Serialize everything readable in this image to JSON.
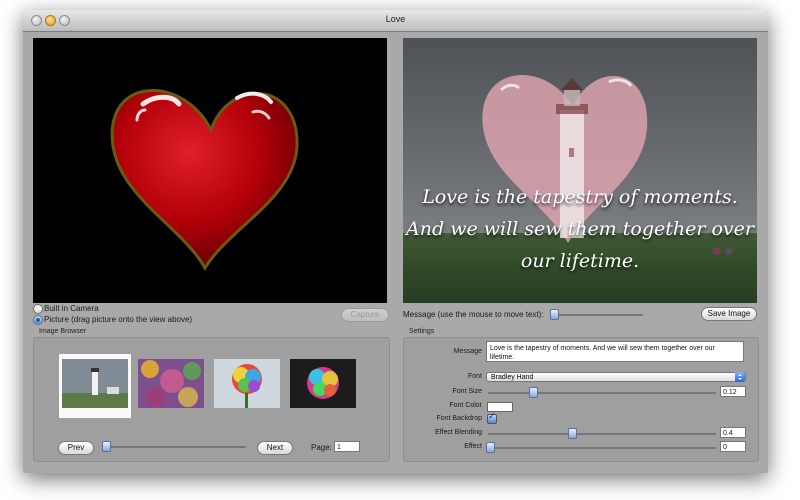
{
  "window": {
    "title": "Love"
  },
  "preview": {
    "quote_lines": [
      "Love is the tapestry of moments.",
      "And we will sew them together over",
      "our lifetime."
    ]
  },
  "source": {
    "radio_camera_label": "Built in Camera",
    "radio_picture_label": "Picture (drag picture onto the view above)",
    "selected": "picture",
    "capture_label": "Capture"
  },
  "message_bar": {
    "label": "Message (use the mouse to move text):",
    "save_label": "Save Image"
  },
  "image_browser": {
    "title": "Image Browser",
    "thumbnails": [
      "lighthouse-thumbnail",
      "flowers-thumbnail",
      "rainbow-rose-thumbnail",
      "rainbow-rose-2-thumbnail"
    ],
    "selected_index": 0,
    "prev_label": "Prev",
    "next_label": "Next",
    "page_label": "Page:",
    "page_value": "1",
    "zoom_slider_value": 0.0
  },
  "settings": {
    "title": "Settings",
    "message_label": "Message",
    "message_value": "Love is the tapestry of moments. And we will sew them together over our lifetime.",
    "font_label": "Font",
    "font_value": "Bradley Hand",
    "font_size_label": "Font Size",
    "font_size_value": "0.12",
    "font_color_label": "Font Color",
    "font_color_value": "#ffffff",
    "font_backdrop_label": "Font Backdrop",
    "font_backdrop_checked": true,
    "effect_blending_label": "Effect Blending",
    "effect_blending_value": "0.4",
    "effect_label": "Effect",
    "effect_value": "0"
  },
  "colors": {
    "window_bg": "#a9a9a9",
    "heart_red": "#c4000a",
    "accent_blue": "#2a66d6"
  }
}
